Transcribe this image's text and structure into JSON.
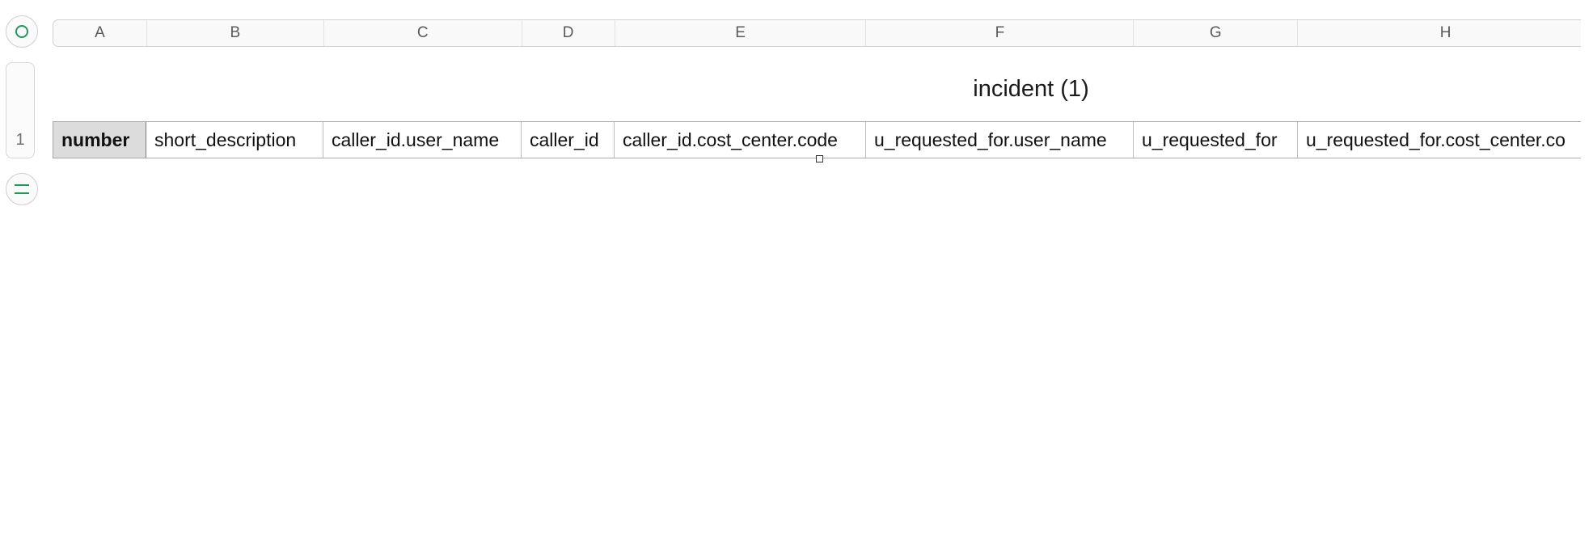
{
  "sheet": {
    "title": "incident (1)",
    "row_number": "1",
    "columns": [
      "A",
      "B",
      "C",
      "D",
      "E",
      "F",
      "G",
      "H"
    ],
    "header_cells": [
      "number",
      "short_description",
      "caller_id.user_name",
      "caller_id",
      "caller_id.cost_center.code",
      "u_requested_for.user_name",
      "u_requested_for",
      "u_requested_for.cost_center.co"
    ]
  },
  "icons": {
    "select_all": "circle-icon",
    "add_row": "equals-icon",
    "resize": "resize-handle-icon"
  },
  "colors": {
    "accent": "#1d9a5b",
    "header_cell_fill": "#dcdcdc"
  }
}
